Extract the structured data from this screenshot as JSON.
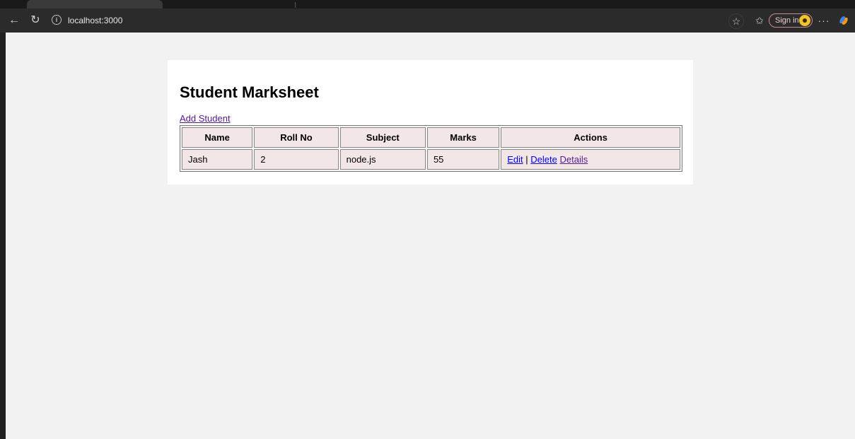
{
  "browser": {
    "url": "localhost:3000",
    "signin_label": "Sign in"
  },
  "page": {
    "title": "Student Marksheet",
    "add_link": "Add Student"
  },
  "table": {
    "headers": [
      "Name",
      "Roll No",
      "Subject",
      "Marks",
      "Actions"
    ],
    "rows": [
      {
        "name": "Jash",
        "roll_no": "2",
        "subject": "node.js",
        "marks": "55",
        "actions": {
          "edit": "Edit",
          "separator": "|",
          "delete": "Delete",
          "details": "Details"
        }
      }
    ]
  },
  "icons": {
    "back": "back-arrow-icon",
    "reload": "reload-icon",
    "info": "info-icon",
    "favorite": "star-icon",
    "favorites": "favorites-list-icon",
    "more": "more-icon",
    "copilot": "copilot-icon"
  }
}
